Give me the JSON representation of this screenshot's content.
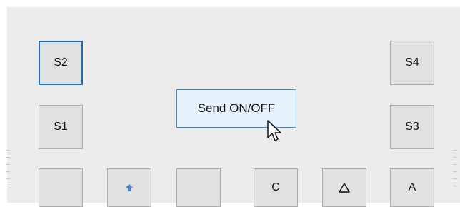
{
  "buttons": {
    "s2": "S2",
    "s4": "S4",
    "s1": "S1",
    "s3": "S3",
    "c": "C",
    "a": "A",
    "up_icon": "up-arrow-icon",
    "triangle_icon": "triangle-icon"
  },
  "tooltip": {
    "text": "Send ON/OFF"
  },
  "colors": {
    "focus_border": "#1a6fc9",
    "tooltip_bg": "#e5f1fb",
    "tooltip_border": "#3c8ad4",
    "arrow": "#4a7fd4"
  }
}
